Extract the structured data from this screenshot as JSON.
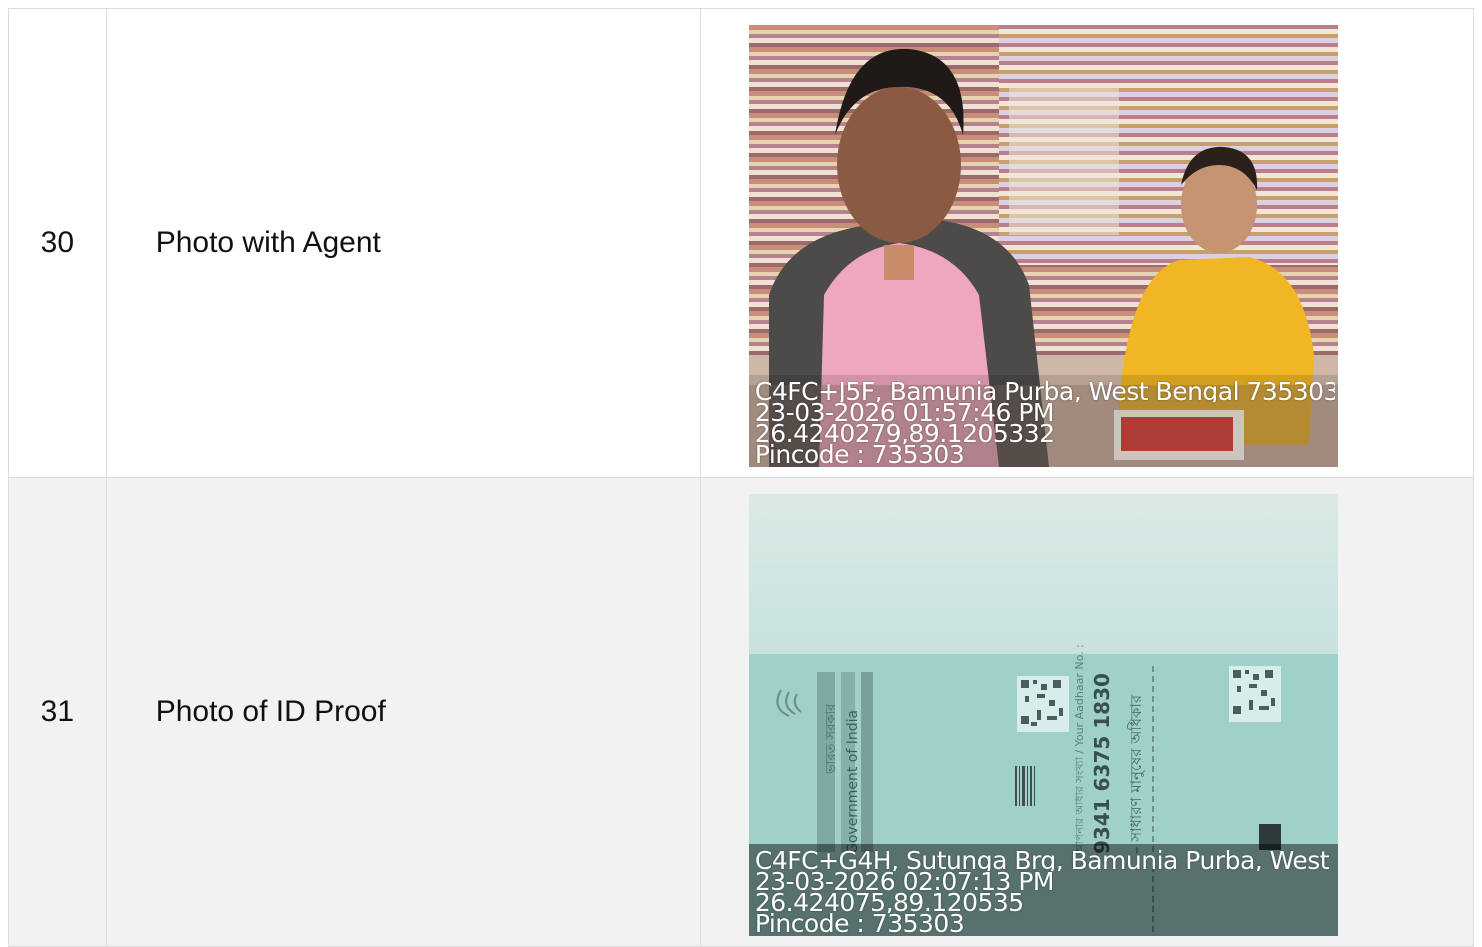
{
  "rows": [
    {
      "number": "30",
      "label": "Photo with Agent",
      "stamp": {
        "address": "C4FC+J5F, Bamunia Purba, West Bengal 735303, ...",
        "datetime": "23-03-2026 01:57:46 PM",
        "coords": "26.4240279,89.1205332",
        "pincode": "Pincode : 735303"
      }
    },
    {
      "number": "31",
      "label": "Photo of ID Proof",
      "stamp": {
        "address": "C4FC+G4H, Sutunga Brg, Bamunia Purba, West ...",
        "datetime": "23-03-2026 02:07:13 PM",
        "coords": "26.424075,89.120535",
        "pincode": "Pincode : 735303"
      },
      "card": {
        "aadhaar_number": "9341 6375 1830",
        "aadhaar_label": "আপনার আধার সংখ্যা / Your Aadhaar No. :",
        "tagline": "– সাধারণ মানুষের অধিকার",
        "gov_bn": "ভারত সরকার",
        "gov_en": "Government of India"
      }
    }
  ]
}
